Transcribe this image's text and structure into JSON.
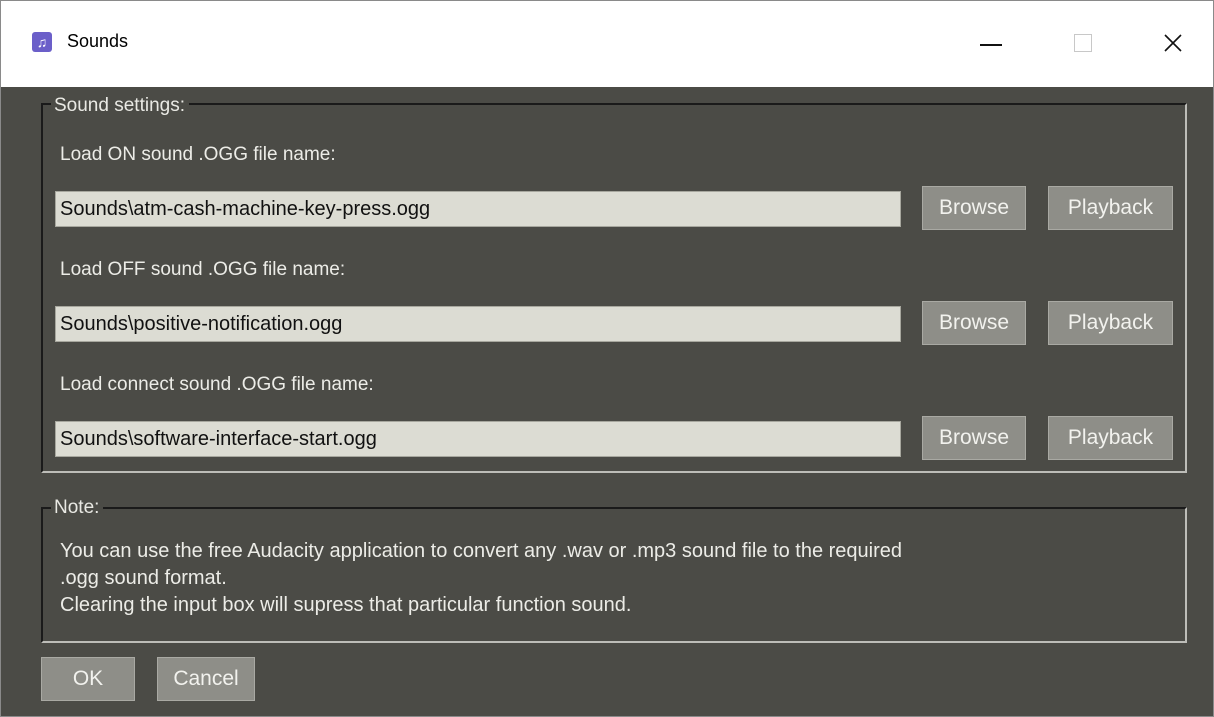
{
  "window": {
    "title": "Sounds",
    "icon": "music-note-icon",
    "controls": {
      "minimize": "minimize-icon",
      "maximize": "maximize-icon",
      "close": "close-icon"
    }
  },
  "sound_settings": {
    "legend": "Sound settings:",
    "rows": [
      {
        "label": "Load ON sound .OGG file name:",
        "value": "Sounds\\atm-cash-machine-key-press.ogg",
        "browse": "Browse",
        "playback": "Playback"
      },
      {
        "label": "Load OFF sound .OGG file name:",
        "value": "Sounds\\positive-notification.ogg",
        "browse": "Browse",
        "playback": "Playback"
      },
      {
        "label": "Load connect sound .OGG file name:",
        "value": "Sounds\\software-interface-start.ogg",
        "browse": "Browse",
        "playback": "Playback"
      }
    ]
  },
  "note": {
    "legend": "Note:",
    "lines": [
      "You can use the free Audacity application to convert any .wav or .mp3 sound file to the required",
      ".ogg sound format.",
      "Clearing the input box will supress that particular function sound."
    ]
  },
  "footer": {
    "ok": "OK",
    "cancel": "Cancel"
  },
  "colors": {
    "background": "#4b4b46",
    "field": "#dcdcd3",
    "button": "#8e8e88",
    "icon": "#6b5fc9"
  }
}
